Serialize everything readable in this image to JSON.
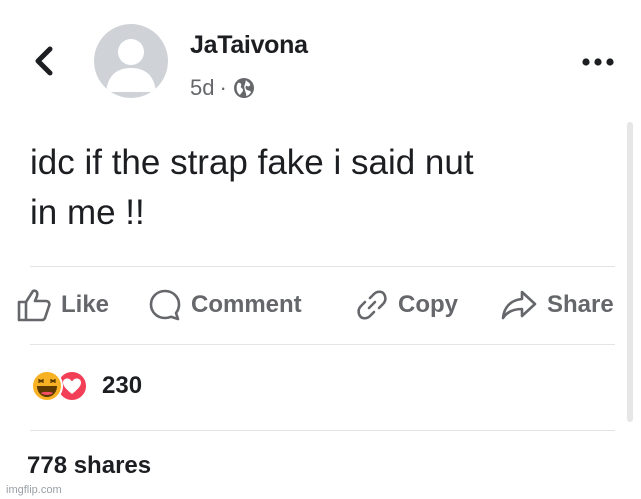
{
  "post": {
    "author": "JaTaivona",
    "time": "5d",
    "dot": "·",
    "text_line1": "idc if the strap fake i said nut",
    "text_line2": "in me !!"
  },
  "actions": {
    "like": "Like",
    "comment": "Comment",
    "copy": "Copy",
    "share": "Share"
  },
  "reactions": {
    "count": "230"
  },
  "shares": {
    "label": "778 shares"
  },
  "watermark": "imgflip.com",
  "colors": {
    "text": "#1c1e21",
    "secondary": "#65676b",
    "avatar_bg": "#cfd3d8",
    "love": "#f33e58",
    "haha": "#f7b125",
    "divider": "#e3e4e7"
  },
  "icons": [
    "back-chevron-icon",
    "avatar-silhouette-icon",
    "globe-icon",
    "more-dots-icon",
    "thumbs-up-icon",
    "comment-bubble-icon",
    "link-icon",
    "share-arrow-icon",
    "haha-reaction-icon",
    "love-reaction-icon"
  ]
}
